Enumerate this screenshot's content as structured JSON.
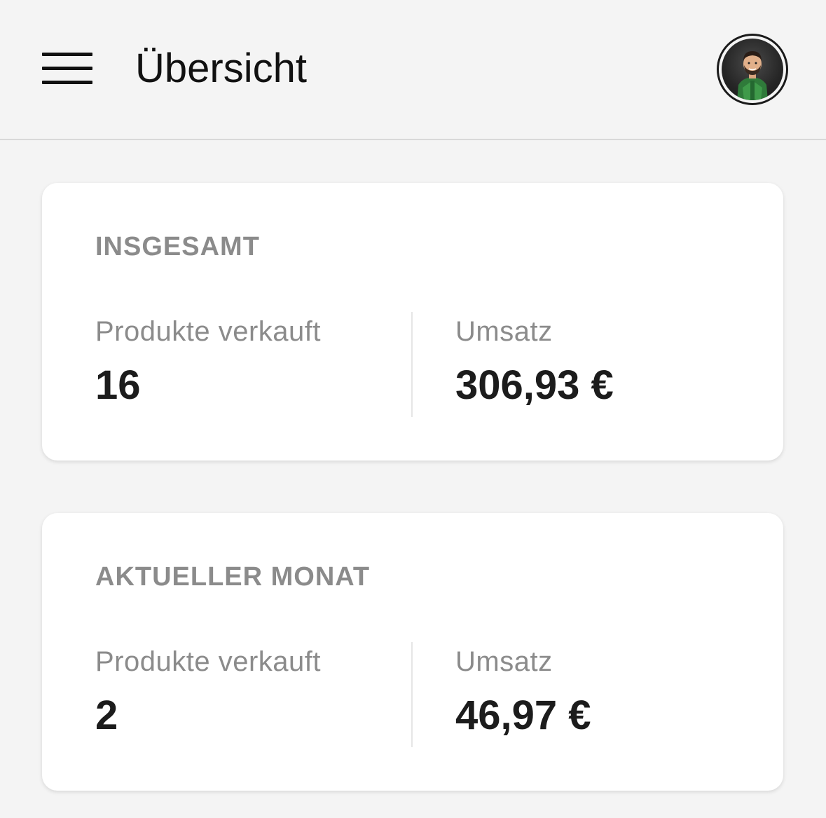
{
  "header": {
    "title": "Übersicht",
    "menu_icon": "hamburger-menu-icon",
    "avatar_icon": "user-avatar"
  },
  "cards": [
    {
      "heading": "INSGESAMT",
      "products_label": "Produkte verkauft",
      "products_value": "16",
      "revenue_label": "Umsatz",
      "revenue_value": "306,93 €"
    },
    {
      "heading": "AKTUELLER MONAT",
      "products_label": "Produkte verkauft",
      "products_value": "2",
      "revenue_label": "Umsatz",
      "revenue_value": "46,97 €"
    }
  ],
  "colors": {
    "background": "#f4f4f4",
    "card": "#ffffff",
    "muted_text": "#8b8b8b",
    "primary_text": "#1c1c1c"
  }
}
